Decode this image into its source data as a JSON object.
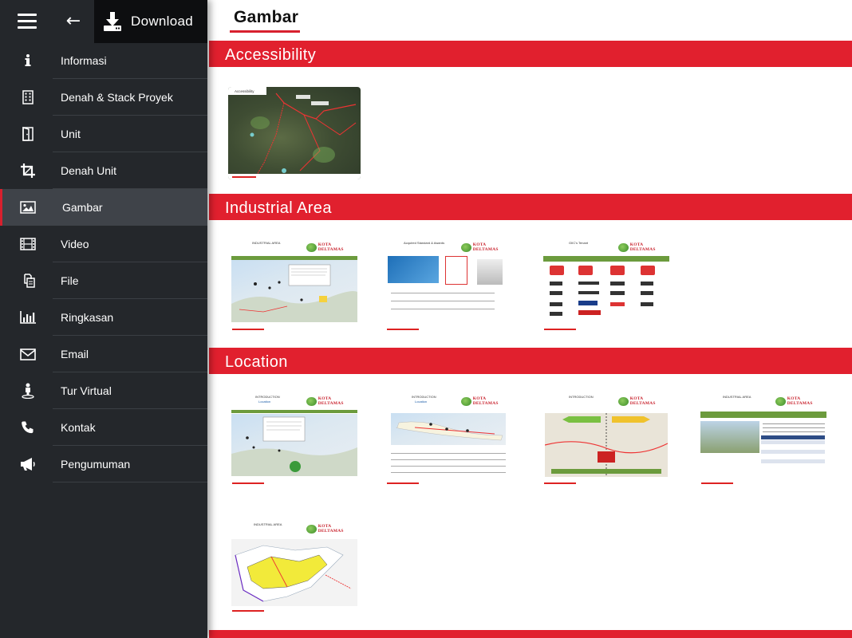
{
  "toolbar": {
    "download_label": "Download"
  },
  "menu": {
    "items": [
      {
        "label": "Informasi",
        "icon": "info-icon"
      },
      {
        "label": "Denah & Stack Proyek",
        "icon": "building-icon"
      },
      {
        "label": "Unit",
        "icon": "door-icon"
      },
      {
        "label": "Denah Unit",
        "icon": "crop-icon"
      },
      {
        "label": "Gambar",
        "icon": "image-icon",
        "active": true
      },
      {
        "label": "Video",
        "icon": "film-icon"
      },
      {
        "label": "File",
        "icon": "copy-icon"
      },
      {
        "label": "Ringkasan",
        "icon": "bar-chart-icon"
      },
      {
        "label": "Email",
        "icon": "envelope-icon"
      },
      {
        "label": "Tur Virtual",
        "icon": "street-view-icon"
      },
      {
        "label": "Kontak",
        "icon": "phone-icon"
      },
      {
        "label": "Pengumuman",
        "icon": "bullhorn-icon"
      }
    ]
  },
  "main": {
    "title": "Gambar",
    "sections": [
      {
        "title": "Accessibility",
        "thumbs": 1
      },
      {
        "title": "Industrial Area",
        "thumbs": 3
      },
      {
        "title": "Location",
        "thumbs": 5
      }
    ]
  },
  "thumb_text": {
    "industrial_area": "INDUSTRIAL AREA",
    "introduction": "INTRODUCTION",
    "location": "Location",
    "accessibility": "Accessibility",
    "acquired": "Acquired Standard & Awards",
    "tenant": "GIIC's Tenant",
    "logo": "KOTA DELTAMAS"
  },
  "colors": {
    "accent": "#e1202e",
    "sidebar_bg": "#24272b",
    "active_bg": "#3f4349"
  }
}
